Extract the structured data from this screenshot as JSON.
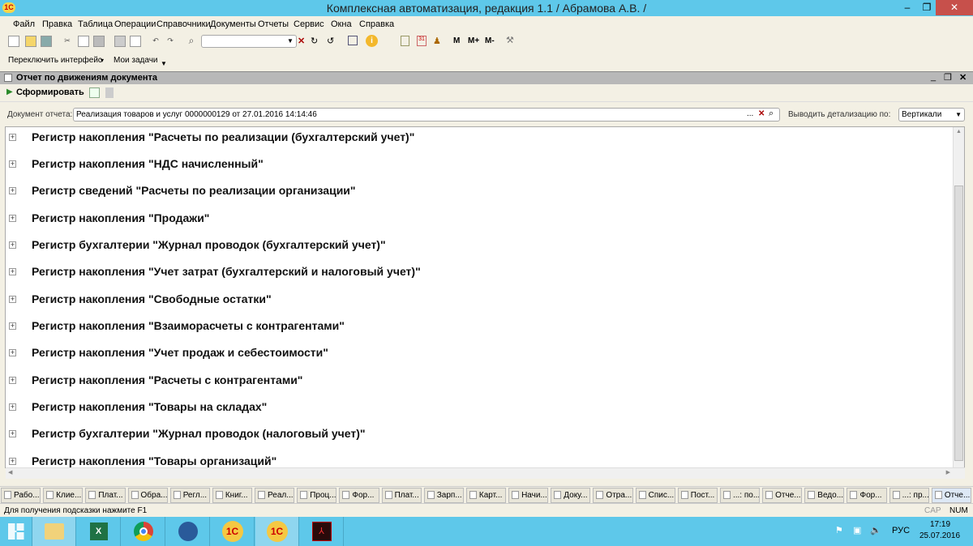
{
  "window": {
    "title": "Комплексная автоматизация, редакция 1.1 / Абрамова А.В. /",
    "minimize": "‒",
    "restore": "❐",
    "close": "✕"
  },
  "menu": [
    "Файл",
    "Правка",
    "Таблица",
    "Операции",
    "Справочники",
    "Документы",
    "Отчеты",
    "Сервис",
    "Окна",
    "Справка"
  ],
  "toolbar": {
    "search_value": "",
    "memory": [
      "M",
      "M+",
      "M-"
    ]
  },
  "toolbar2": {
    "switch_interface": "Переключить интерфейс",
    "my_tasks": "Мои задачи"
  },
  "panel": {
    "title": "Отчет по движениям документа",
    "generate": "Сформировать"
  },
  "fields": {
    "doc_label": "Документ отчета:",
    "doc_value": "Реализация товаров и услуг 0000000129 от 27.01.2016 14:14:46",
    "detail_label": "Выводить детализацию по:",
    "detail_value": "Вертикали"
  },
  "registers": [
    "Регистр накопления \"Расчеты по реализации (бухгалтерский учет)\"",
    "Регистр накопления \"НДС начисленный\"",
    "Регистр сведений \"Расчеты по реализации организации\"",
    "Регистр накопления \"Продажи\"",
    "Регистр бухгалтерии \"Журнал проводок (бухгалтерский учет)\"",
    "Регистр накопления \"Учет затрат (бухгалтерский и налоговый учет)\"",
    "Регистр накопления \"Свободные остатки\"",
    "Регистр накопления \"Взаиморасчеты с контрагентами\"",
    "Регистр накопления \"Учет продаж и себестоимости\"",
    "Регистр накопления \"Расчеты с контрагентами\"",
    "Регистр накопления \"Товары на складах\"",
    "Регистр бухгалтерии \"Журнал проводок (налоговый учет)\"",
    "Регистр накопления \"Товары организаций\""
  ],
  "window_tabs": [
    "Рабо...",
    "Клие...",
    "Плат...",
    "Обра...",
    "Регл...",
    "Книг...",
    "Реал...",
    "Проц...",
    "Фор...",
    "Плат...",
    "Зарп...",
    "Карт...",
    "Начи...",
    "Доку...",
    "Отра...",
    "Спис...",
    "Пост...",
    "...: по...",
    "Отче...",
    "Ведо...",
    "Фор...",
    "...: пр...",
    "Отче..."
  ],
  "status": {
    "hint": "Для получения подсказки нажмите F1",
    "cap": "CAP",
    "num": "NUM"
  },
  "taskbar": {
    "lang": "РУС",
    "time": "17:19",
    "date": "25.07.2016",
    "apps": [
      "windows-start",
      "file-explorer",
      "excel",
      "chrome",
      "thunderbird",
      "1c",
      "1c",
      "acrobat"
    ]
  }
}
